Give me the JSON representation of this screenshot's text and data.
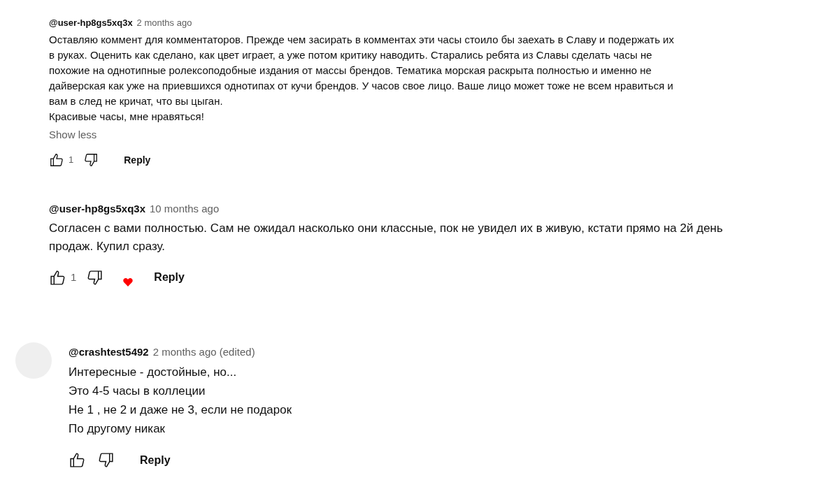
{
  "comments": [
    {
      "kind": "compact",
      "author": "@user-hp8gs5xq3x",
      "time": "2 months ago",
      "lines": [
        "Оставляю коммент для комментаторов. Прежде чем засирать в комментах эти часы стоило бы заехать в Славу и подержать их",
        "в руках. Оценить как сделано, как цвет играет, а уже потом критику наводить. Старались ребята из Славы сделать часы не",
        "похожие на однотипные ролексоподобные издания от массы брендов. Тематика морская раскрыта полностью и именно не",
        "дайверская как уже на приевшихся однотипах от кучи брендов. У часов свое лицо. Ваше лицо может тоже не всем нравиться и",
        "вам в след не кричат, что вы цыган.",
        "Красивые часы, мне нравяться!"
      ],
      "toggle": "Show less",
      "likes": "1",
      "hearted": false,
      "reply": "Reply"
    },
    {
      "kind": "regular",
      "author": "@user-hp8gs5xq3x",
      "time": "10 months ago",
      "lines": [
        "Согласен с вами полностью. Сам не ожидал насколько они классные, пок не увидел их в живую, кстати прямо на 2й день",
        "продаж. Купил сразу."
      ],
      "likes": "1",
      "hearted": true,
      "reply": "Reply"
    },
    {
      "kind": "avatar",
      "author": "@crashtest5492",
      "time": "2 months ago (edited)",
      "lines": [
        "Интересные - достойные, но...",
        "Это 4-5 часы в коллеции",
        "Не 1 , не 2 и даже не 3, если не подарок",
        "По другому никак"
      ],
      "hearted": false,
      "reply": "Reply"
    }
  ]
}
